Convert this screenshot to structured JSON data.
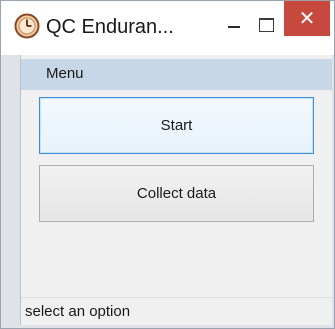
{
  "window": {
    "title": "QC Enduran...",
    "close_glyph": "✕",
    "icon": "clock-icon",
    "colors": {
      "close_button": "#c7483c",
      "menubar": "#c8d7e8",
      "focused_border": "#3d8ed9"
    }
  },
  "menubar": {
    "items": [
      {
        "label": "Menu"
      }
    ]
  },
  "buttons": {
    "start_label": "Start",
    "collect_label": "Collect data"
  },
  "statusbar": {
    "text": "select an option"
  }
}
